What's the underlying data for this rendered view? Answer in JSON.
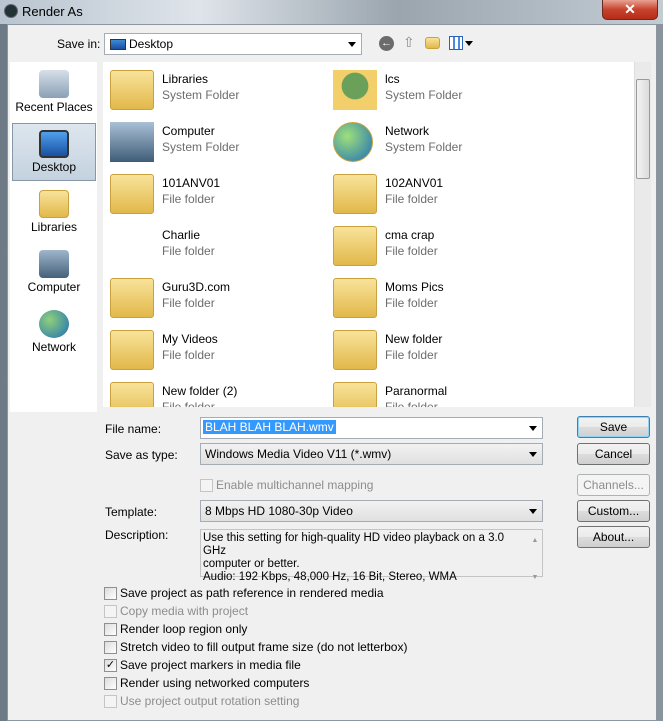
{
  "window": {
    "title": "Render As",
    "close": "✕"
  },
  "toolbar": {
    "save_in_label": "Save in:",
    "save_in_value": "Desktop"
  },
  "sidebar": {
    "items": [
      {
        "label": "Recent Places"
      },
      {
        "label": "Desktop",
        "selected": true
      },
      {
        "label": "Libraries"
      },
      {
        "label": "Computer"
      },
      {
        "label": "Network"
      }
    ]
  },
  "files": [
    {
      "name": "Libraries",
      "type": "System Folder"
    },
    {
      "name": "lcs",
      "type": "System Folder"
    },
    {
      "name": "Computer",
      "type": "System Folder"
    },
    {
      "name": "Network",
      "type": "System Folder"
    },
    {
      "name": "101ANV01",
      "type": "File folder"
    },
    {
      "name": "102ANV01",
      "type": "File folder"
    },
    {
      "name": "Charlie",
      "type": "File folder"
    },
    {
      "name": "cma crap",
      "type": "File folder"
    },
    {
      "name": "Guru3D.com",
      "type": "File folder"
    },
    {
      "name": "Moms Pics",
      "type": "File folder"
    },
    {
      "name": "My Videos",
      "type": "File folder"
    },
    {
      "name": "New folder",
      "type": "File folder"
    },
    {
      "name": "New folder (2)",
      "type": "File folder"
    },
    {
      "name": "Paranormal",
      "type": "File folder"
    }
  ],
  "form": {
    "file_name_label": "File name:",
    "file_name_value": "BLAH BLAH BLAH.wmv",
    "save_type_label": "Save as type:",
    "save_type_value": "Windows Media Video V11 (*.wmv)",
    "multichannel": "Enable multichannel mapping",
    "template_label": "Template:",
    "template_value": "8 Mbps HD 1080-30p Video",
    "description_label": "Description:",
    "description_lines": [
      "Use this setting for high-quality HD video playback on a 3.0 GHz",
      "computer or better.",
      "Audio: 192 Kbps, 48,000 Hz, 16 Bit, Stereo, WMA"
    ]
  },
  "buttons": {
    "save": "Save",
    "cancel": "Cancel",
    "channels": "Channels...",
    "custom": "Custom...",
    "about": "About..."
  },
  "options": [
    {
      "label": "Save project as path reference in rendered media",
      "checked": false,
      "enabled": true
    },
    {
      "label": "Copy media with project",
      "checked": false,
      "enabled": false
    },
    {
      "label": "Render loop region only",
      "checked": false,
      "enabled": true
    },
    {
      "label": "Stretch video to fill output frame size (do not letterbox)",
      "checked": false,
      "enabled": true
    },
    {
      "label": "Save project markers in media file",
      "checked": true,
      "enabled": true
    },
    {
      "label": "Render using networked computers",
      "checked": false,
      "enabled": true
    },
    {
      "label": "Use project output rotation setting",
      "checked": false,
      "enabled": false
    }
  ]
}
